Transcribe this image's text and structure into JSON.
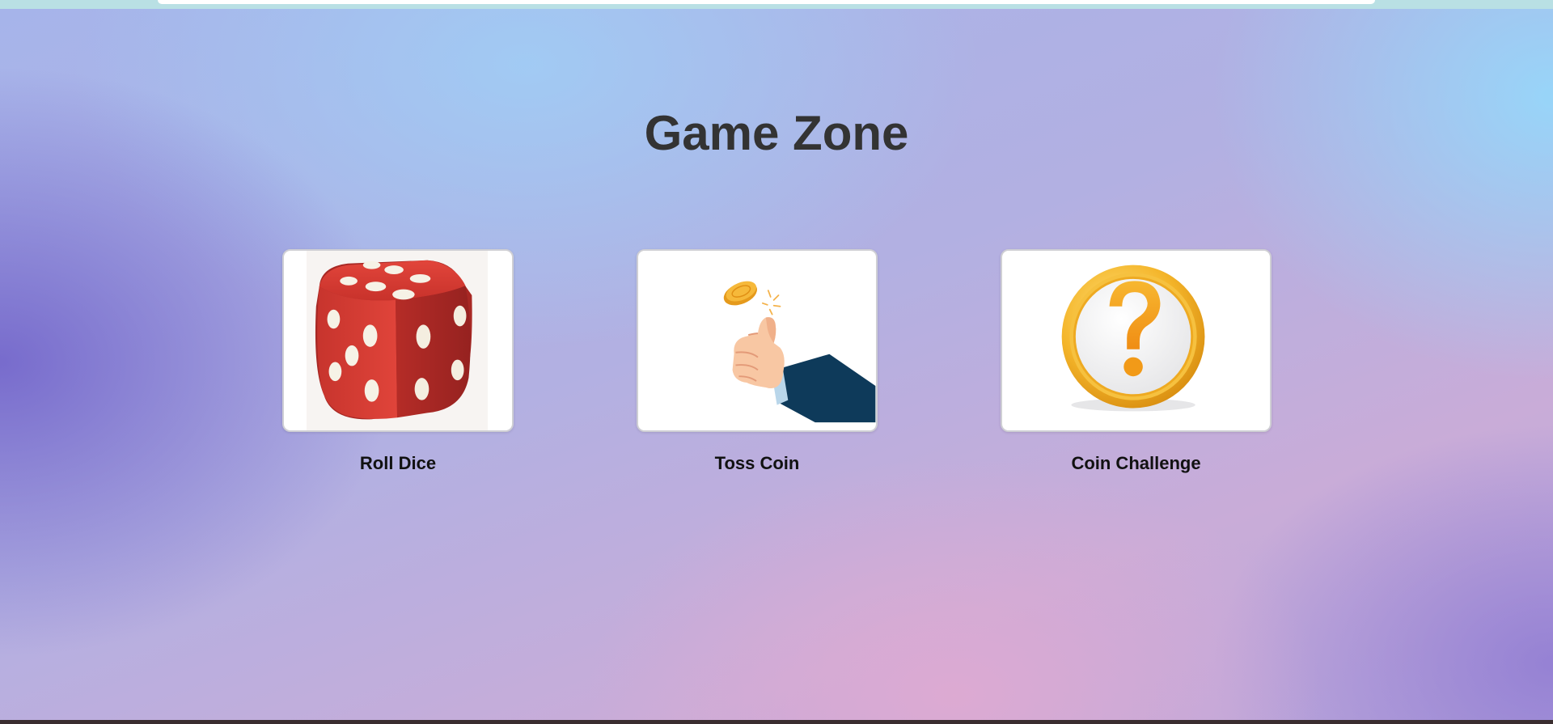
{
  "page": {
    "title": "Game Zone"
  },
  "games": [
    {
      "label": "Roll Dice",
      "image_icon": "red-dice-icon"
    },
    {
      "label": "Toss Coin",
      "image_icon": "coin-toss-hand-icon"
    },
    {
      "label": "Coin Challenge",
      "image_icon": "gold-question-coin-icon"
    }
  ],
  "colors": {
    "title_text": "#333333",
    "label_text": "#111111",
    "dice_red": "#d23a32",
    "coin_gold": "#f4b52a",
    "sleeve_navy": "#0e3a5a"
  }
}
